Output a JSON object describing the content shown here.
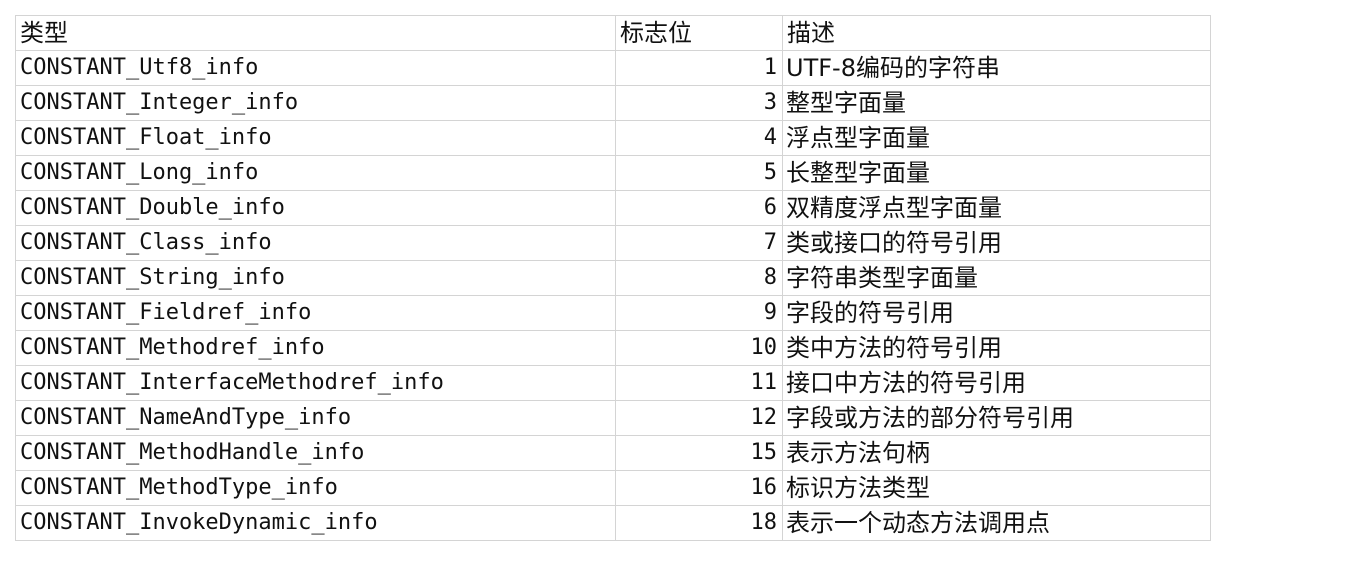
{
  "table": {
    "headers": [
      "类型",
      "标志位",
      "描述"
    ],
    "rows": [
      {
        "type": "CONSTANT_Utf8_info",
        "tag": "1",
        "desc": "UTF-8编码的字符串"
      },
      {
        "type": "CONSTANT_Integer_info",
        "tag": "3",
        "desc": "整型字面量"
      },
      {
        "type": "CONSTANT_Float_info",
        "tag": "4",
        "desc": "浮点型字面量"
      },
      {
        "type": "CONSTANT_Long_info",
        "tag": "5",
        "desc": "长整型字面量"
      },
      {
        "type": "CONSTANT_Double_info",
        "tag": "6",
        "desc": "双精度浮点型字面量"
      },
      {
        "type": "CONSTANT_Class_info",
        "tag": "7",
        "desc": "类或接口的符号引用"
      },
      {
        "type": "CONSTANT_String_info",
        "tag": "8",
        "desc": "字符串类型字面量"
      },
      {
        "type": "CONSTANT_Fieldref_info",
        "tag": "9",
        "desc": "字段的符号引用"
      },
      {
        "type": "CONSTANT_Methodref_info",
        "tag": "10",
        "desc": "类中方法的符号引用"
      },
      {
        "type": "CONSTANT_InterfaceMethodref_info",
        "tag": "11",
        "desc": "接口中方法的符号引用"
      },
      {
        "type": "CONSTANT_NameAndType_info",
        "tag": "12",
        "desc": "字段或方法的部分符号引用"
      },
      {
        "type": "CONSTANT_MethodHandle_info",
        "tag": "15",
        "desc": "表示方法句柄"
      },
      {
        "type": "CONSTANT_MethodType_info",
        "tag": "16",
        "desc": "标识方法类型"
      },
      {
        "type": "CONSTANT_InvokeDynamic_info",
        "tag": "18",
        "desc": "表示一个动态方法调用点"
      }
    ]
  }
}
